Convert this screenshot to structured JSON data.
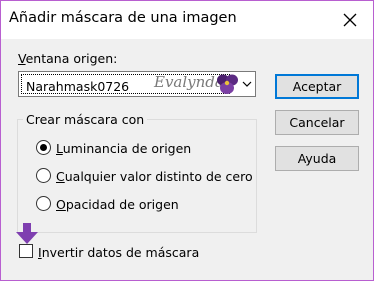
{
  "window": {
    "title": "Añadir máscara de una imagen"
  },
  "source": {
    "label_key": "V",
    "label_rest": "entana origen:",
    "combo_value": "Narahmask0726",
    "watermark": "Evalynda"
  },
  "buttons": {
    "accept": "Aceptar",
    "cancel": "Cancelar",
    "help": "Ayuda"
  },
  "mask_group": {
    "legend": "Crear máscara con",
    "options": [
      {
        "key": "L",
        "rest": "uminancia de origen",
        "selected": true
      },
      {
        "key": "C",
        "rest": "ualquier valor distinto de cero",
        "selected": false
      },
      {
        "key": "O",
        "rest": "pacidad de origen",
        "selected": false
      }
    ]
  },
  "invert": {
    "key": "I",
    "rest": "nvertir datos de máscara",
    "checked": false
  },
  "colors": {
    "border": "#b85fd0",
    "accent": "#0078d7",
    "arrow": "#7f3fb0"
  },
  "icons": [
    "close-icon",
    "chevron-down-icon",
    "flower-icon",
    "arrow-down-icon"
  ]
}
